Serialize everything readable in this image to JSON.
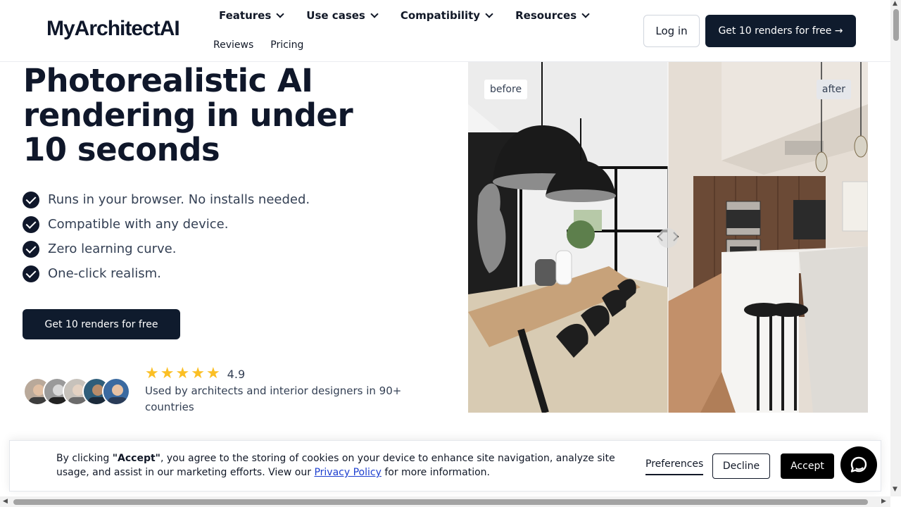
{
  "header": {
    "logo": "MyArchitectAI",
    "nav_dropdowns": [
      "Features",
      "Use cases",
      "Compatibility",
      "Resources"
    ],
    "nav_links": [
      "Reviews",
      "Pricing"
    ],
    "login_label": "Log in",
    "cta_label": "Get 10 renders for free →"
  },
  "hero": {
    "title_lines": [
      "Photorealistic AI",
      "rendering in under",
      "10 seconds"
    ],
    "features": [
      "Runs in your browser. No installs needed.",
      "Compatible with any device.",
      "Zero learning curve.",
      "One-click realism."
    ],
    "cta_label": "Get 10 renders for free",
    "rating": {
      "stars": 5,
      "value": "4.9"
    },
    "social_proof": "Used by architects and interior designers in 90+ countries"
  },
  "compare": {
    "before_label": "before",
    "after_label": "after"
  },
  "cookie": {
    "text_prefix": "By clicking ",
    "text_bold": "\"Accept\"",
    "text_middle": ", you agree to the storing of cookies on your device to enhance site navigation, analyze site usage, and assist in our marketing efforts. View our ",
    "link_label": "Privacy Policy",
    "text_suffix": " for more information.",
    "preferences_label": "Preferences",
    "decline_label": "Decline",
    "accept_label": "Accept"
  },
  "colors": {
    "primary": "#0f1b2d",
    "star": "#fbbf24",
    "link": "#1d3fcf"
  },
  "icons": {
    "feature_bullet": "check-circle-icon",
    "chat": "chat-bubble-icon",
    "rating": "star-icon"
  }
}
